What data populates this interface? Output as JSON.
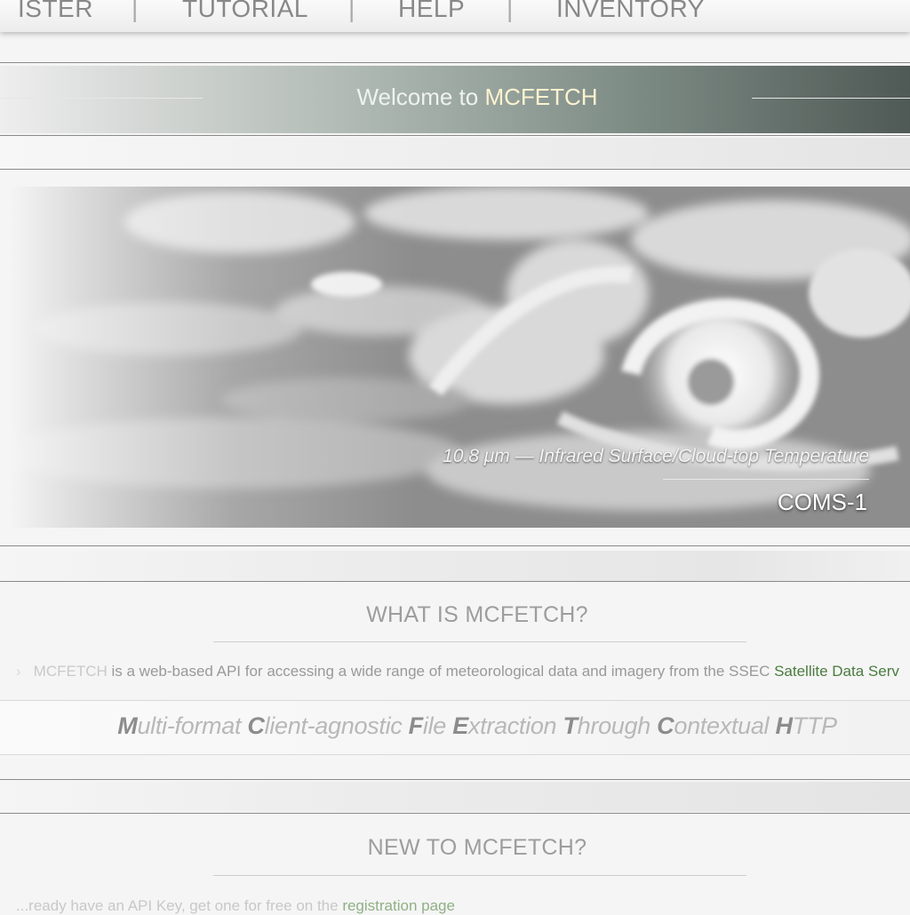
{
  "nav": {
    "items": [
      "ISTER",
      "TUTORIAL",
      "HELP",
      "INVENTORY"
    ],
    "separator": "|"
  },
  "welcome": {
    "prefix": "Welcome to",
    "brand": "MCFETCH"
  },
  "hero": {
    "caption": "10.8 μm — Infrared Surface/Cloud-top Temperature",
    "satellite": "COMS-1"
  },
  "what_is": {
    "title": "WHAT IS MCFETCH?",
    "bullet": "›",
    "brand": "MCFETCH",
    "text": " is a web-based API for accessing a wide range of meteorological data and imagery from the SSEC ",
    "link": "Satellite Data Serv",
    "acronym": [
      {
        "cap": "M",
        "rest": "ulti-format "
      },
      {
        "cap": "C",
        "rest": "lient-agnostic "
      },
      {
        "cap": "F",
        "rest": "ile "
      },
      {
        "cap": "E",
        "rest": "xtraction "
      },
      {
        "cap": "T",
        "rest": "hrough "
      },
      {
        "cap": "C",
        "rest": "ontextual "
      },
      {
        "cap": "H",
        "rest": "TTP"
      }
    ]
  },
  "new_to": {
    "title": "NEW TO MCFETCH?",
    "text": "...ready have an API Key, get one for free on the ",
    "link": "registration page"
  },
  "colors": {
    "link_green": "#4a7c3f",
    "accent_cream": "#fff3cf"
  }
}
